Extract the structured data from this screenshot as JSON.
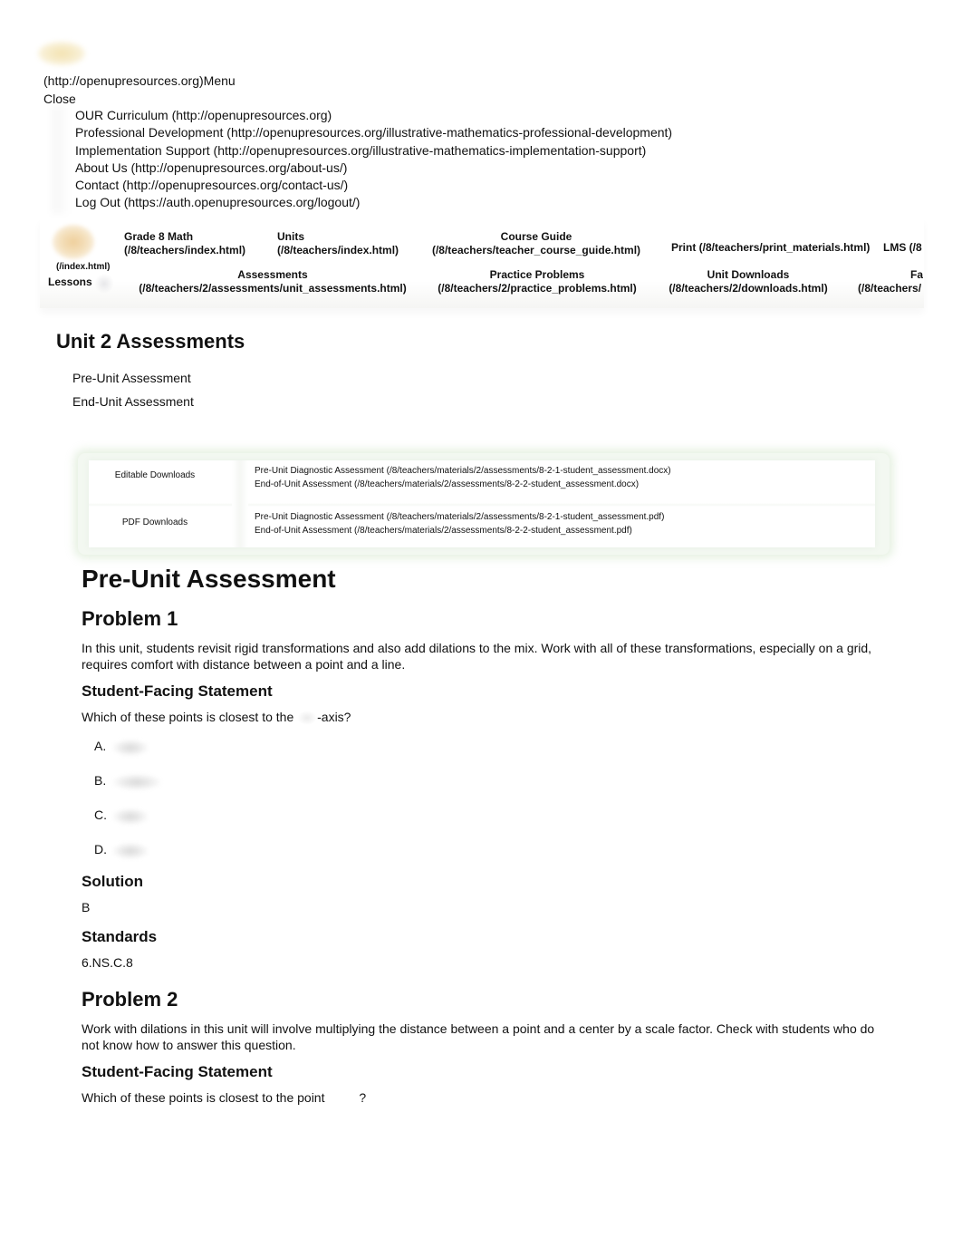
{
  "top_menu": {
    "logo_icon": "open-up-resources-logo",
    "menu_line": "(http://openupresources.org)Menu",
    "close_label": "Close",
    "items": [
      {
        "label": "OUR Curriculum (http://openupresources.org)"
      },
      {
        "label": "Professional Development (http://openupresources.org/illustrative-mathematics-professional-development)"
      },
      {
        "label": "Implementation Support (http://openupresources.org/illustrative-mathematics-implementation-support)"
      },
      {
        "label": "About Us (http://openupresources.org/about-us/)"
      },
      {
        "label": "Contact (http://openupresources.org/contact-us/)"
      },
      {
        "label": "Log Out (https://auth.openupresources.org/logout/)"
      }
    ]
  },
  "nav_bar": {
    "logo_link": "(/index.html)",
    "lessons_label": "Lessons",
    "row1": [
      {
        "title": "Grade 8 Math",
        "href": "(/8/teachers/index.html)"
      },
      {
        "title": "Units",
        "href": "(/8/teachers/index.html)"
      },
      {
        "title": "Course Guide",
        "href": "(/8/teachers/teacher_course_guide.html)"
      },
      {
        "title": "Print (/8/teachers/print_materials.html)"
      },
      {
        "title": "LMS (/8"
      }
    ],
    "row2": [
      {
        "title": "Assessments",
        "href": "(/8/teachers/2/assessments/unit_assessments.html)"
      },
      {
        "title": "Practice Problems",
        "href": "(/8/teachers/2/practice_problems.html)"
      },
      {
        "title": "Unit Downloads",
        "href": "(/8/teachers/2/downloads.html)"
      },
      {
        "title": "Fa",
        "href": "(/8/teachers/"
      }
    ]
  },
  "page": {
    "title": "Unit 2 Assessments",
    "toc": [
      "Pre-Unit Assessment",
      "End-Unit Assessment"
    ]
  },
  "downloads": {
    "rows": [
      {
        "label": "Editable Downloads",
        "links": [
          "Pre-Unit Diagnostic Assessment (/8/teachers/materials/2/assessments/8-2-1-student_assessment.docx)",
          "End-of-Unit Assessment (/8/teachers/materials/2/assessments/8-2-2-student_assessment.docx)"
        ]
      },
      {
        "label": "PDF Downloads",
        "links": [
          "Pre-Unit Diagnostic Assessment (/8/teachers/materials/2/assessments/8-2-1-student_assessment.pdf)",
          "End-of-Unit Assessment (/8/teachers/materials/2/assessments/8-2-2-student_assessment.pdf)"
        ]
      }
    ]
  },
  "assessment": {
    "title": "Pre-Unit Assessment",
    "problems": [
      {
        "title": "Problem 1",
        "narrative": "In this unit, students revisit rigid transformations and also add dilations to the mix. Work with all of these transformations, especially on a grid, requires comfort with distance between a point and a line.",
        "statement_heading": "Student-Facing Statement",
        "statement_before": "Which of these points is closest to the ",
        "statement_after": "-axis?",
        "choices": [
          {
            "letter": "A."
          },
          {
            "letter": "B."
          },
          {
            "letter": "C."
          },
          {
            "letter": "D."
          }
        ],
        "solution_heading": "Solution",
        "solution": "B",
        "standards_heading": "Standards",
        "standards": "6.NS.C.8"
      },
      {
        "title": "Problem 2",
        "narrative": "Work with dilations in this unit will involve multiplying the distance between a point and a center by a scale factor. Check with students who do not know how to answer this question.",
        "statement_heading": "Student-Facing Statement",
        "statement_before": "Which of these points is closest to the point ",
        "statement_after": "?"
      }
    ]
  }
}
